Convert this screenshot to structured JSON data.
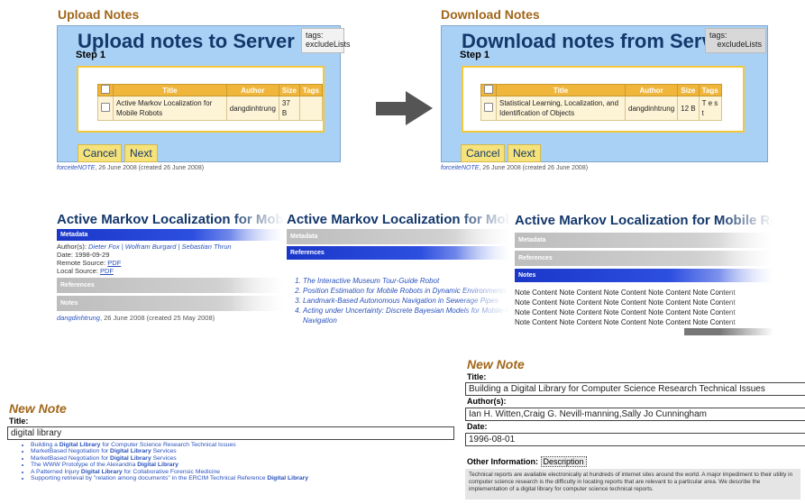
{
  "upload": {
    "section_title": "Upload Notes",
    "heading": "Upload notes to Server",
    "step": "Step 1",
    "tags_label": "tags:",
    "tags_value": "excludeLists",
    "columns": [
      "Title",
      "Author",
      "Size",
      "Tags"
    ],
    "row": {
      "title": "Active Markov Localization for Mobile Robots",
      "author": "dangdinhtrung",
      "size": "37 B",
      "tags": ""
    },
    "cancel": "Cancel",
    "next": "Next",
    "footer_app": "forceiteNOTE",
    "footer_rest": ", 26 June 2008 (created 26 June 2008)"
  },
  "download": {
    "section_title": "Download Notes",
    "heading": "Download notes from Server",
    "step": "Step 1",
    "tags_label": "tags:",
    "tags_value": "excludeLists",
    "columns": [
      "Title",
      "Author",
      "Size",
      "Tags"
    ],
    "row": {
      "title": "Statistical Learning, Localization, and Identification of Objects",
      "author": "dangdinhtrung",
      "size": "12 B",
      "tags": "T e s t"
    },
    "cancel": "Cancel",
    "next": "Next",
    "footer_app": "forceiteNOTE",
    "footer_rest": ", 26 June 2008 (created 26 June 2008)"
  },
  "paper_title": "Active Markov Localization for Mobile Robots",
  "panel1": {
    "metadata": "Metadata",
    "authors_label": "Author(s): ",
    "authors": "Dieter Fox | Wolfram Burgard | Sebastian Thrun",
    "date": "Date: 1998-09-29",
    "remote_label": "Remote Source: ",
    "remote_link": "PDF",
    "local_label": "Local Source: ",
    "local_link": "PDF",
    "references": "References",
    "notes": "Notes",
    "footer_user": "dangdinhtrung",
    "footer_rest": ", 26 June 2008 (created 25 May 2008)"
  },
  "panel2": {
    "metadata": "Metadata",
    "references": "References",
    "refs": [
      "The Interactive Museum Tour-Guide Robot",
      "Position Estimation for Mobile Robots in Dynamic Environments",
      "Landmark-Based Autonomous Navigation in Sewerage Pipes",
      "Acting under Uncertainty: Discrete Bayesian Models for Mobile-Robot",
      "Navigation"
    ]
  },
  "panel3": {
    "metadata": "Metadata",
    "references": "References",
    "notes": "Notes",
    "note_line": "Note Content Note Content Note Content Note Content Note Content"
  },
  "new_note_left": {
    "heading": "New Note",
    "title_label": "Title:",
    "title_value": "digital library",
    "results": [
      {
        "pre": "Building a ",
        "bold": "Digital Library",
        "post": " for Computer Science Research Technical Issues"
      },
      {
        "pre": "MarketBased Negotiation for ",
        "bold": "Digital Library",
        "post": " Services"
      },
      {
        "pre": "MarketBased Negotiation for ",
        "bold": "Digital Library",
        "post": " Services"
      },
      {
        "pre": "The WWW Prototype of the Alexandria ",
        "bold": "Digital Library",
        "post": ""
      },
      {
        "pre": "A Patterned Injury ",
        "bold": "Digital Library",
        "post": " for Collaborative Forensic Medicine"
      },
      {
        "pre": "Supporting retrieval by \"relation among documents\" in the ERCIM Technical Reference ",
        "bold": "Digital Library",
        "post": ""
      }
    ]
  },
  "new_note_right": {
    "heading": "New Note",
    "title_label": "Title:",
    "title_value": "Building a Digital Library for Computer Science Research Technical Issues",
    "authors_label": "Author(s):",
    "authors_value": "Ian H. Witten,Craig G. Nevill-manning,Sally Jo Cunningham",
    "date_label": "Date:",
    "date_value": "1996-08-01",
    "other_label": "Other Information: ",
    "desc_tab": "Description",
    "description": "Technical reports are available electronically at hundreds of internet sites around the world. A major impediment to their utility in computer science research is the difficulty in locating reports that are relevant to a particular area. We describe the implementation of a digital library for computer science technical reports."
  }
}
